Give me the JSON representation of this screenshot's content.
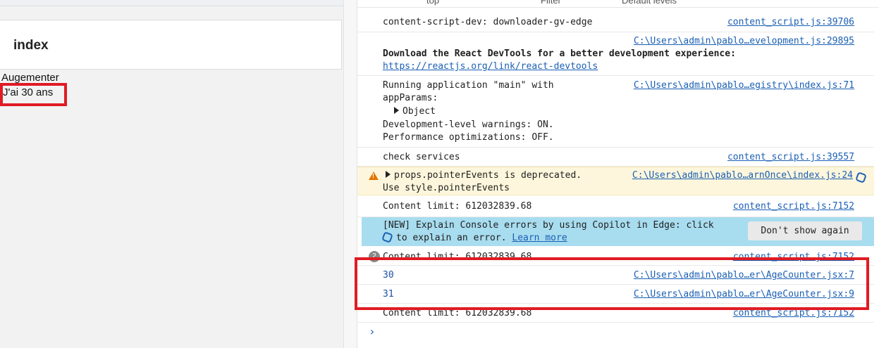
{
  "app": {
    "title": "index",
    "increment_button": "Augementer",
    "age_text": "J'ai 30 ans"
  },
  "toolbar": {
    "context": "top",
    "filter_placeholder": "Filter",
    "levels": "Default levels"
  },
  "console": {
    "messages": [
      {
        "text": "content-script-dev: downloader-gv-edge",
        "source": "content_script.js:39706"
      },
      {
        "text_bold": "Download the React DevTools for a better development experience:",
        "link": "https://reactjs.org/link/react-devtools",
        "source": "C:\\Users\\admin\\pablo…evelopment.js:29895"
      },
      {
        "line1": "Running application \"main\" with",
        "line2": "appParams:",
        "object_label": "Object",
        "line4": "Development-level warnings: ON.",
        "line5": "Performance optimizations: OFF.",
        "source": "C:\\Users\\admin\\pablo…egistry\\index.js:71"
      },
      {
        "text": "check services",
        "source": "content_script.js:39557"
      },
      {
        "line1": "props.pointerEvents is deprecated.",
        "line2": "Use style.pointerEvents",
        "source": "C:\\Users\\admin\\pablo…arnOnce\\index.js:24"
      },
      {
        "text": "Content limit: 612032839.68",
        "source": "content_script.js:7152"
      },
      {
        "line1": "[NEW] Explain Console errors by using Copilot in Edge: click",
        "line2_pre": "to explain an error.",
        "learn_more": "Learn more",
        "dismiss": "Don't show again"
      },
      {
        "text": "Content limit: 612032839.68",
        "source": "content_script.js:7152",
        "count": "2"
      },
      {
        "text": "30",
        "source": "C:\\Users\\admin\\pablo…er\\AgeCounter.jsx:7"
      },
      {
        "text": "31",
        "source": "C:\\Users\\admin\\pablo…er\\AgeCounter.jsx:9"
      },
      {
        "text": "Content limit: 612032839.68",
        "source": "content_script.js:7152"
      }
    ],
    "prompt_symbol": "›"
  }
}
